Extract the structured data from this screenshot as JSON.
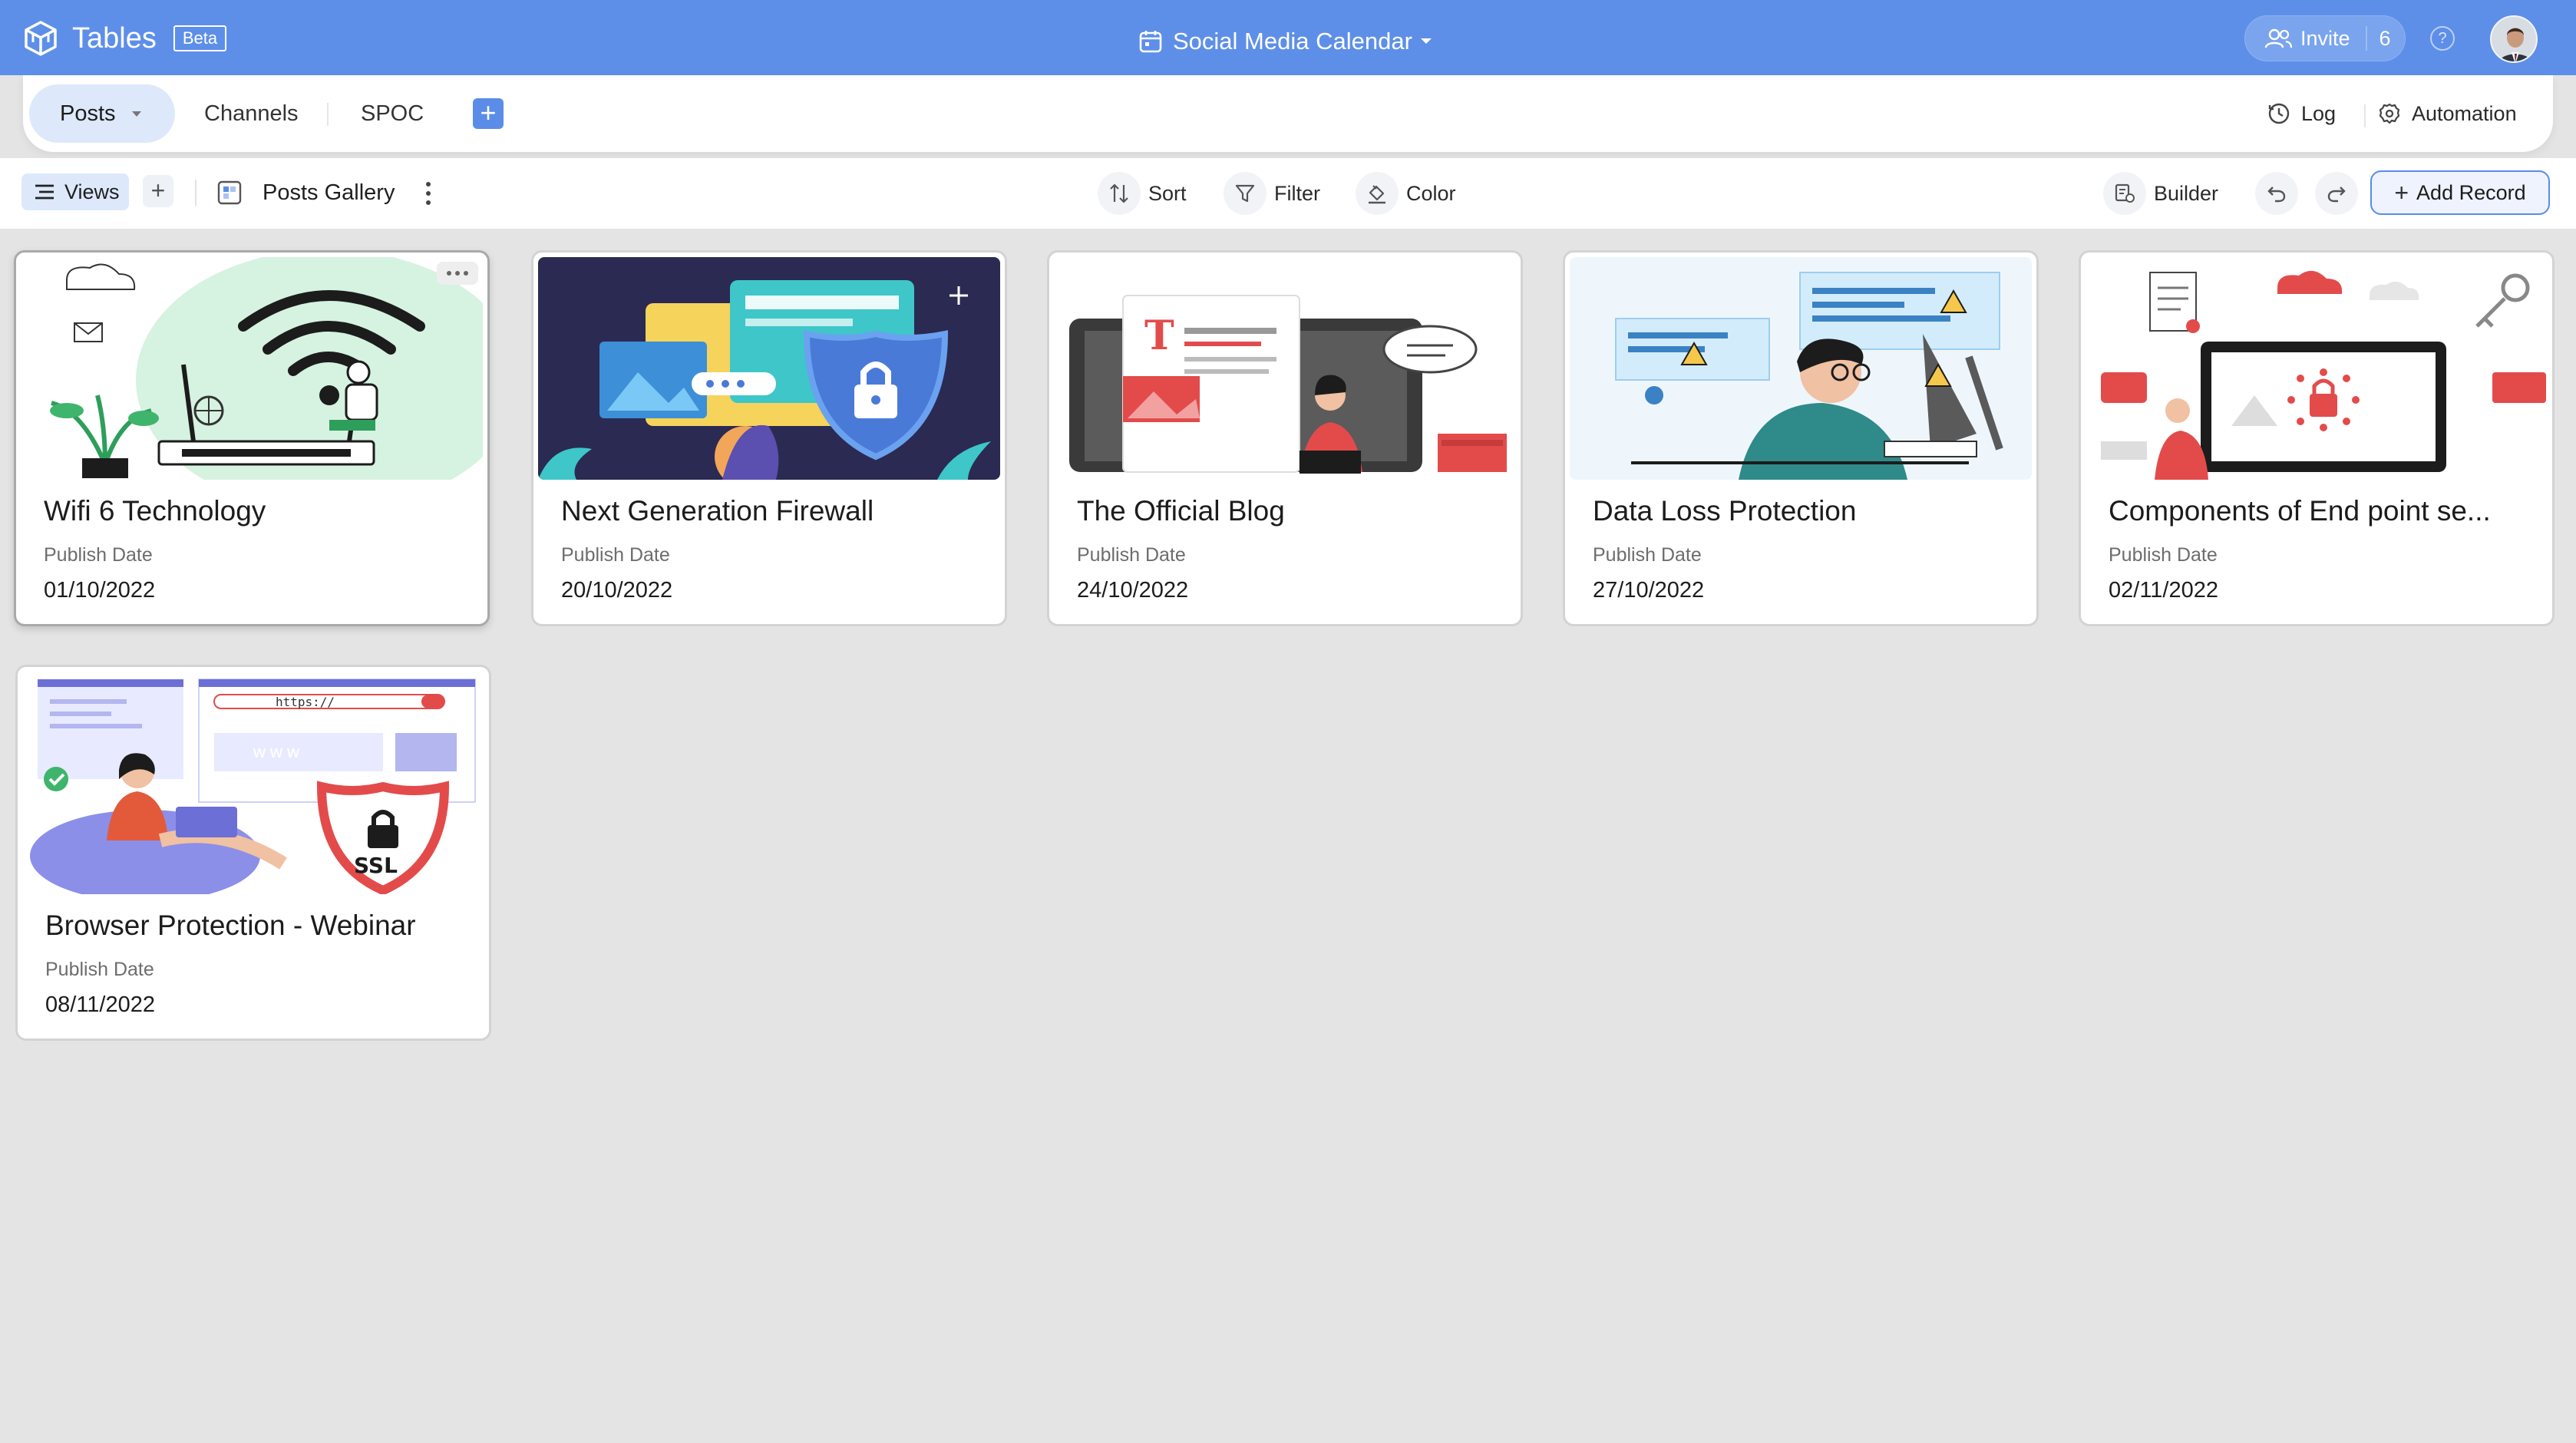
{
  "app": {
    "name": "Tables",
    "badge": "Beta"
  },
  "document": {
    "title": "Social Media Calendar"
  },
  "header": {
    "invite_label": "Invite",
    "member_count": "6",
    "help_label": "?"
  },
  "tabs": [
    {
      "label": "Posts",
      "active": true
    },
    {
      "label": "Channels",
      "active": false
    },
    {
      "label": "SPOC",
      "active": false
    }
  ],
  "tabs_right": {
    "log_label": "Log",
    "automation_label": "Automation"
  },
  "toolbar": {
    "views_label": "Views",
    "view_name": "Posts Gallery",
    "sort_label": "Sort",
    "filter_label": "Filter",
    "color_label": "Color",
    "builder_label": "Builder",
    "add_record_label": "Add Record"
  },
  "cards": [
    {
      "title": "Wifi 6 Technology",
      "field_label": "Publish Date",
      "field_value": "01/10/2022",
      "image": "wifi-illustration"
    },
    {
      "title": "Next Generation Firewall",
      "field_label": "Publish Date",
      "field_value": "20/10/2022",
      "image": "firewall-illustration"
    },
    {
      "title": "The Official Blog",
      "field_label": "Publish Date",
      "field_value": "24/10/2022",
      "image": "blog-illustration"
    },
    {
      "title": "Data Loss Protection",
      "field_label": "Publish Date",
      "field_value": "27/10/2022",
      "image": "data-loss-illustration"
    },
    {
      "title": "Components of End point se...",
      "field_label": "Publish Date",
      "field_value": "02/11/2022",
      "image": "endpoint-illustration"
    },
    {
      "title": "Browser Protection - Webinar",
      "field_label": "Publish Date",
      "field_value": "08/11/2022",
      "image": "browser-ssl-illustration"
    }
  ],
  "colors": {
    "brand_blue": "#5e8fe8",
    "accent": "#5b8ce8",
    "active_tab_bg": "#dde8fb",
    "canvas": "#e4e4e4"
  }
}
